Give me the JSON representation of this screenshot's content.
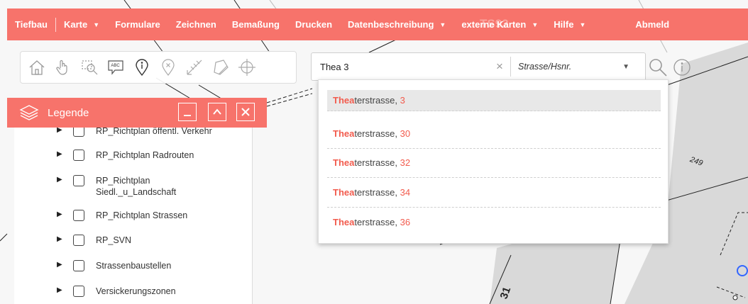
{
  "nav": {
    "items": [
      {
        "label": "Tiefbau",
        "caret": false
      },
      {
        "label": "Karte",
        "caret": true
      },
      {
        "label": "Formulare",
        "caret": false
      },
      {
        "label": "Zeichnen",
        "caret": false
      },
      {
        "label": "Bemaßung",
        "caret": false
      },
      {
        "label": "Drucken",
        "caret": false
      },
      {
        "label": "Datenbeschreibung",
        "caret": true
      },
      {
        "label": "externe Karten",
        "caret": true
      },
      {
        "label": "Hilfe",
        "caret": true
      },
      {
        "label": "Abmeld",
        "caret": false
      }
    ],
    "bg_overlay_text": "TS92"
  },
  "toolbar": {
    "tools": [
      {
        "icon": "home-icon"
      },
      {
        "icon": "pan-hand-icon"
      },
      {
        "icon": "zoom-box-icon"
      },
      {
        "icon": "text-label-icon",
        "text": "ABC"
      },
      {
        "icon": "info-pin-icon"
      },
      {
        "icon": "remove-marker-icon"
      },
      {
        "icon": "measure-line-icon"
      },
      {
        "icon": "measure-area-icon"
      },
      {
        "icon": "crosshair-icon"
      }
    ]
  },
  "search": {
    "value": "Thea 3",
    "clear": "×",
    "type_label": "Strasse/Hsnr.",
    "suggestions": [
      {
        "match": "Thea",
        "rest": "terstrasse, ",
        "num": "3"
      },
      {
        "match": "Thea",
        "rest": "terstrasse, ",
        "num": "30"
      },
      {
        "match": "Thea",
        "rest": "terstrasse, ",
        "num": "32"
      },
      {
        "match": "Thea",
        "rest": "terstrasse, ",
        "num": "34"
      },
      {
        "match": "Thea",
        "rest": "terstrasse, ",
        "num": "36"
      }
    ]
  },
  "legend": {
    "title": "Legende",
    "items": [
      {
        "label": "RP_Richtplan öffentl. Verkehr"
      },
      {
        "label": "RP_Richtplan Radrouten"
      },
      {
        "label": "RP_Richtplan Siedl._u_Landschaft"
      },
      {
        "label": "RP_Richtplan Strassen"
      },
      {
        "label": "RP_SVN"
      },
      {
        "label": "Strassenbaustellen"
      },
      {
        "label": "Versickerungszonen"
      }
    ]
  },
  "map": {
    "labels": [
      "249",
      "31"
    ]
  },
  "colors": {
    "accent": "#f7736b",
    "highlight": "#f25b4d"
  }
}
